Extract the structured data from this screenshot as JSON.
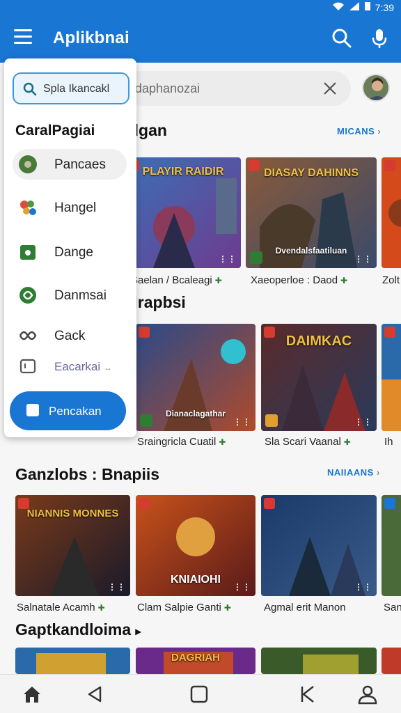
{
  "status": {
    "time": "7:39"
  },
  "appbar": {
    "title": "Aplikbnai",
    "search_icon": "search-icon",
    "mic_icon": "mic-icon"
  },
  "search": {
    "placeholder": "idaphanozai"
  },
  "drawer": {
    "search_text": "Spla Ikancakl",
    "header": "CaralPagiai",
    "items": [
      {
        "label": "Pancaes",
        "icon": "planet-icon",
        "active": true
      },
      {
        "label": "Hangel",
        "icon": "colorful-cluster-icon",
        "active": false
      },
      {
        "label": "Dange",
        "icon": "green-square-icon",
        "active": false
      },
      {
        "label": "Danmsai",
        "icon": "green-swirl-icon",
        "active": false
      },
      {
        "label": "Gack",
        "icon": "infinity-icon",
        "active": false
      },
      {
        "label": "Eacarkai",
        "icon": "frame-icon",
        "active": false
      }
    ],
    "button_label": "Pencakan"
  },
  "sections": [
    {
      "title": "dgan",
      "more": "MICANS",
      "cards": [
        {
          "art": "PLAYIR RAIDIR",
          "caption": "Saelan / Bcaleagi",
          "colors": [
            "#3b6fb6",
            "#6e3b8e"
          ]
        },
        {
          "art": "DIASAY DAHINNS",
          "caption": "Xaeoperloe : Daod",
          "colors": [
            "#8a5a3a",
            "#3a4a6a"
          ],
          "overlay": "Dvendalsfaatiluan"
        },
        {
          "art": "",
          "caption": "Zolt",
          "colors": [
            "#d44a1a",
            "#8a3a1a"
          ]
        }
      ]
    },
    {
      "title": "Ilrapbsi",
      "more": "",
      "cards": [
        {
          "art": "",
          "caption": "Sraingricla Cuatil",
          "colors": [
            "#2a4a8a",
            "#b04a2a"
          ],
          "overlay": "Dianaclagathar"
        },
        {
          "art": "DAIMKAC",
          "caption": "Sla Scari Vaanal",
          "colors": [
            "#5a2a2a",
            "#2a3a5a"
          ]
        },
        {
          "art": "",
          "caption": "Ih",
          "colors": [
            "#2a6aaa",
            "#e08a2a"
          ]
        }
      ]
    },
    {
      "title": "Ganzlobs : Bnapiis",
      "more": "NAIIAANS",
      "cards": [
        {
          "art": "NIANNIS MONNES",
          "caption": "Salnatale Acamh",
          "colors": [
            "#7a3a1a",
            "#1a1a2a"
          ]
        },
        {
          "art": "KNIAIOHI",
          "caption": "Clam Salpie Ganti",
          "colors": [
            "#c8521a",
            "#5a1a1a"
          ]
        },
        {
          "art": "",
          "caption": "Agmal erit Manon",
          "colors": [
            "#1a3a6a",
            "#3a5a8a"
          ]
        },
        {
          "art": "",
          "caption": "San",
          "colors": [
            "#4a6a3a",
            "#2a2a2a"
          ]
        }
      ]
    },
    {
      "title": "Gaptkandloima",
      "more": "",
      "cards": [
        {
          "art": "",
          "caption": "",
          "colors": [
            "#2a6aaa",
            "#d0a030"
          ]
        },
        {
          "art": "DAGRIAH",
          "caption": "",
          "colors": [
            "#6a2a8a",
            "#c04a2a"
          ]
        },
        {
          "art": "",
          "caption": "",
          "colors": [
            "#3a5a2a",
            "#a0a030"
          ]
        },
        {
          "art": "",
          "caption": "",
          "colors": [
            "#c03a2a",
            "#602020"
          ]
        }
      ]
    }
  ],
  "bottom_nav": [
    "home-icon",
    "back-icon",
    "square-icon",
    "k-icon",
    "profile-icon"
  ]
}
